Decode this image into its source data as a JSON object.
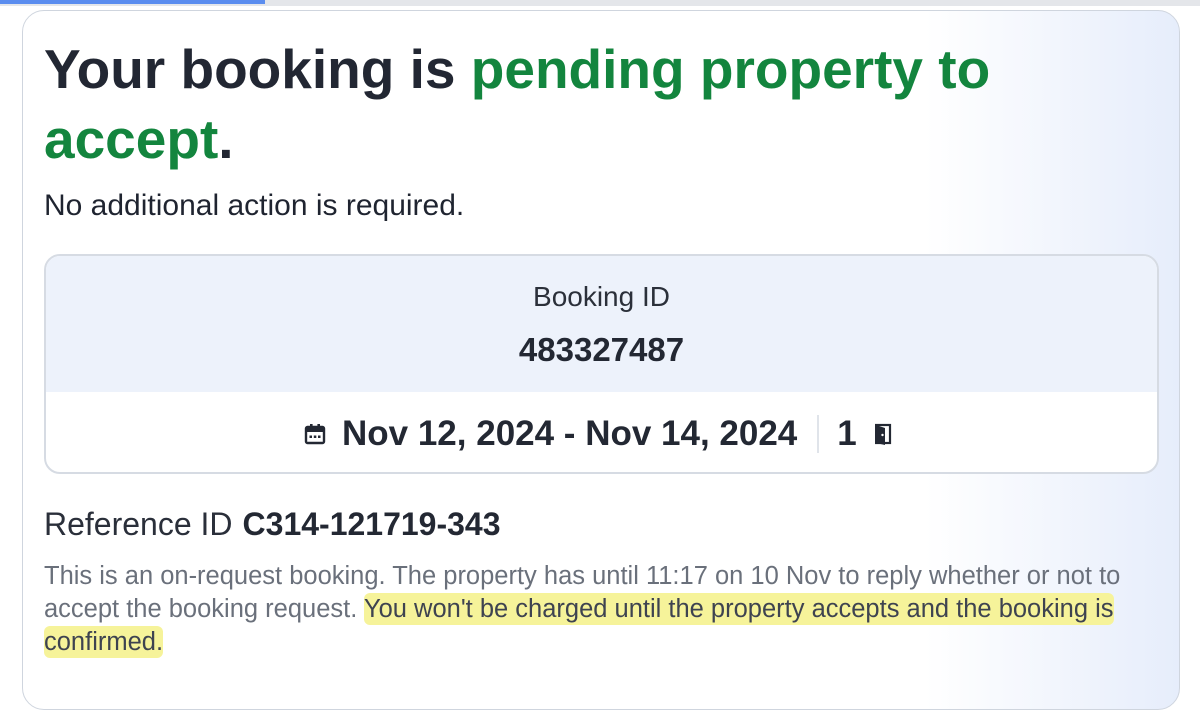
{
  "heading": {
    "part1": "Your booking is ",
    "part2": "pending property to accept",
    "part3": "."
  },
  "subtitle": "No additional action is required.",
  "booking": {
    "id_label": "Booking ID",
    "id_value": "483327487",
    "dates": "Nov 12, 2024 - Nov 14, 2024",
    "rooms": "1",
    "calendar_icon": "calendar-icon",
    "room_icon": "door-icon"
  },
  "reference": {
    "label": "Reference ID",
    "value": "C314-121719-343"
  },
  "notice": {
    "text": "This is an on-request booking. The property has until 11:17 on 10 Nov to reply whether or not to accept the booking request. ",
    "highlighted": "You won't be charged until the property accepts and the booking is confirmed."
  },
  "colors": {
    "accent_green": "#13853e",
    "highlight": "#f6f39a",
    "info_bg": "#edf2fb"
  }
}
